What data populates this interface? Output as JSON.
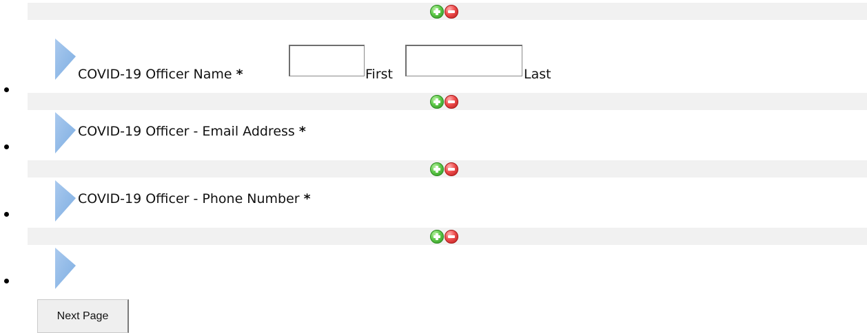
{
  "form": {
    "required_marker": "*",
    "questions": [
      {
        "label": "COVID-19 Officer Name",
        "subfields": [
          {
            "value": "",
            "caption": "First"
          },
          {
            "value": "",
            "caption": "Last"
          }
        ]
      },
      {
        "label": "COVID-19 Officer - Email Address"
      },
      {
        "label": "COVID-19 Officer - Phone Number"
      }
    ],
    "next_button_label": "Next Page"
  },
  "icons": {
    "add": "add-circle-icon",
    "remove": "remove-circle-icon",
    "arrow": "triangle-arrow-icon"
  },
  "colors": {
    "toolbar_bg": "#f1f1f1",
    "add_green": "#5fc94a",
    "remove_red": "#ee4d4d",
    "arrow_blue": "#8fb8e6"
  }
}
